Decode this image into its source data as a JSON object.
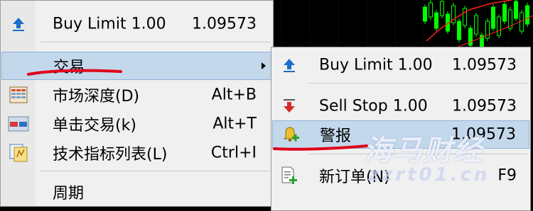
{
  "main_menu": {
    "items": [
      {
        "label": "Buy Limit 1.00",
        "shortcut": "1.09573",
        "icon": "buy-arrow-icon"
      },
      {
        "label": "交易",
        "shortcut": "",
        "icon": "",
        "has_submenu": true,
        "highlighted": true
      },
      {
        "label": "市场深度(D)",
        "shortcut": "Alt+B",
        "icon": "market-depth-icon"
      },
      {
        "label": "单击交易(k)",
        "shortcut": "Alt+T",
        "icon": "one-click-trading-icon"
      },
      {
        "label": "技术指标列表(L)",
        "shortcut": "Ctrl+I",
        "icon": "indicators-list-icon"
      },
      {
        "label": "周期",
        "shortcut": "",
        "icon": ""
      }
    ]
  },
  "sub_menu": {
    "items": [
      {
        "label": "Buy Limit 1.00",
        "shortcut": "1.09573",
        "icon": "buy-arrow-icon"
      },
      {
        "label": "Sell Stop 1.00",
        "shortcut": "1.09573",
        "icon": "sell-arrow-icon"
      },
      {
        "label": "警报",
        "shortcut": "1.09573",
        "icon": "alert-bell-icon",
        "highlighted": true
      },
      {
        "label": "新订单(N)",
        "shortcut": "F9",
        "icon": "new-order-icon"
      }
    ]
  },
  "watermark": {
    "main": "海马财经",
    "sub": "zzrt01.cn"
  },
  "colors": {
    "highlight": "#c4d8ec",
    "annotation_red": "#e0001a",
    "candle_green": "#00ff00",
    "ma_red": "#ff2020"
  }
}
